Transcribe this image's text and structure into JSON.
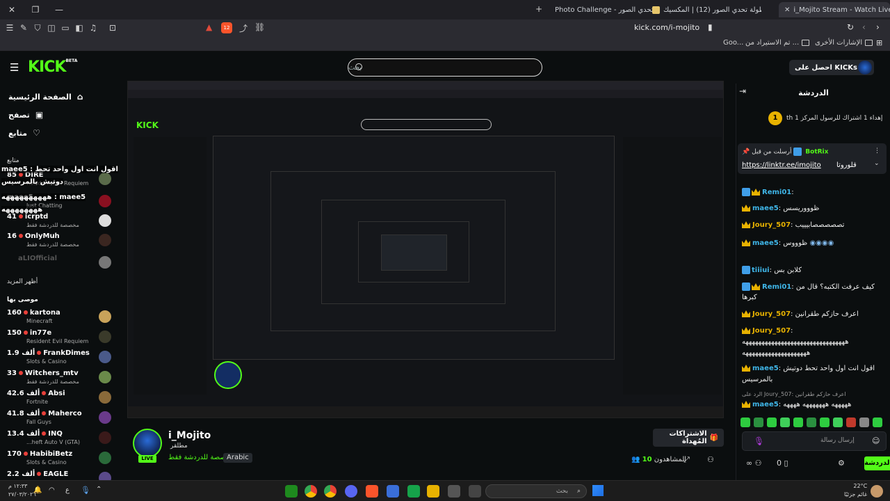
{
  "browser": {
    "tabs": [
      {
        "label": "i_Mojito Stream - Watch Live"
      },
      {
        "label": "بطولة تحدي الصور (12) | المكسيك..."
      },
      {
        "label": "Photo Challenge - لعبة تحدي الصور"
      }
    ],
    "address": "kick.com/i-mojito",
    "shield_count": "12",
    "bookmarks": [
      "الإشارات الأخرى",
      "تم الاستيراد من ...",
      "Goo..."
    ]
  },
  "kick": {
    "logo": "KICK",
    "beta": "BETA",
    "search_placeholder": "بحث",
    "get_kicks": "احصل على KICKs"
  },
  "sidebar": {
    "nav": [
      {
        "label": "الصفحة الرئيسية"
      },
      {
        "label": "تصفح"
      },
      {
        "label": "متابع"
      }
    ],
    "following_header": "متابع",
    "show_more": "أظهر المزيد",
    "recommended_header": "موصى بها",
    "following": [
      {
        "viewers": "85",
        "name": "DIRE",
        "category": "Resident Evil Requiem"
      },
      {
        "viewers": "",
        "name": "maee5",
        "category": "Just Chatting"
      },
      {
        "viewers": "41",
        "name": "icrptd",
        "category": "مخصصة للدردشة فقط"
      },
      {
        "viewers": "16",
        "name": "OnlyMuh",
        "category": "مخصصة للدردشة فقط"
      },
      {
        "viewers": "",
        "name": "aLIOfficial",
        "category": ""
      }
    ],
    "recommended": [
      {
        "viewers": "160",
        "name": "kartona",
        "category": "Minecraft"
      },
      {
        "viewers": "150",
        "name": "in77e",
        "category": "Resident Evil Requiem"
      },
      {
        "viewers": "1.9 ألف",
        "name": "FrankDimes",
        "category": "Slots & Casino"
      },
      {
        "viewers": "33",
        "name": "Witchers_mtv",
        "category": "مخصصة للدردشة فقط"
      },
      {
        "viewers": "42.6 ألف",
        "name": "Absi",
        "category": "Fortnite"
      },
      {
        "viewers": "41.8 ألف",
        "name": "Maherco",
        "category": "Fall Guys"
      },
      {
        "viewers": "13.4 ألف",
        "name": "INQ",
        "category": "...heft Auto V (GTA)"
      },
      {
        "viewers": "170",
        "name": "HabibiBetz",
        "category": "Slots & Casino"
      },
      {
        "viewers": "2.2 ألف",
        "name": "EAGLE",
        "category": ""
      }
    ],
    "overlay_lines": [
      "اقول انت اول واحد تحط : maee5",
      "دوتيش بالمرسيس",
      "maee5 : ههههههههههه",
      "ههههههههه"
    ]
  },
  "stream": {
    "name": "i_Mojito",
    "role": "مطلقر",
    "category": "مخصصة للدردشة فقط",
    "language": "Arabic",
    "subscribe_label": "الاشتراكات المُهداة",
    "viewers_label": "المشاهدون",
    "viewers_count": "10"
  },
  "chat": {
    "title": "الدردشة",
    "gifter_line": "إهداء 1 اشتراك للرسول المركز 1 th",
    "gifter_rank": "1",
    "pinned": {
      "header": "أرسلت من قبل",
      "user": "BotRix",
      "link": "https://linktr.ee/imojito",
      "text": "قلوروتا"
    },
    "messages": [
      {
        "user": "Remi01",
        "text": ""
      },
      {
        "user": "maee5",
        "text": "ظوووريسس"
      },
      {
        "user": "Joury_507",
        "text": "تصصصصصابيييب"
      },
      {
        "user": "maee5",
        "text": "ظوووس"
      },
      {
        "user": "tiiiui",
        "text": "كلابن بس"
      },
      {
        "user": "Remi01",
        "text": "كيف عرفت الكتبه؟ قال من"
      },
      {
        "user": "",
        "text": "كبرها"
      },
      {
        "user": "Joury_507",
        "text": "اعرف حازكم طقرانين"
      },
      {
        "user": "Joury_507",
        "text": ""
      },
      {
        "user": "",
        "text": "ههههههههههههههههههههههههههههههههه"
      },
      {
        "user": "",
        "text": "ههههههههههههههههههههه"
      },
      {
        "user": "maee5",
        "text": "اقول انت اول واحد تحط دوتيش"
      },
      {
        "user": "",
        "text": "بالمرسيس"
      },
      {
        "user": "",
        "text": "الرد على Joury_507: اعرف حازكم طقرانين"
      },
      {
        "user": "maee5",
        "text": "هههههه هههههههه ههههه"
      }
    ],
    "input_placeholder": "إرسال رسالة",
    "send_label": "الدردشة",
    "points": "0"
  },
  "taskbar": {
    "search_placeholder": "بحث",
    "time": "١٢:٣٣ م",
    "date": "٢٧/٠٣/٢٠٢٦",
    "weather_temp": "22°C",
    "weather_text": "غائم جزئيًا",
    "lang": "ع"
  },
  "colors": {
    "kick_green": "#53fc18",
    "crown_gold": "#e8b200",
    "badge_blue": "#3f9ee8"
  }
}
